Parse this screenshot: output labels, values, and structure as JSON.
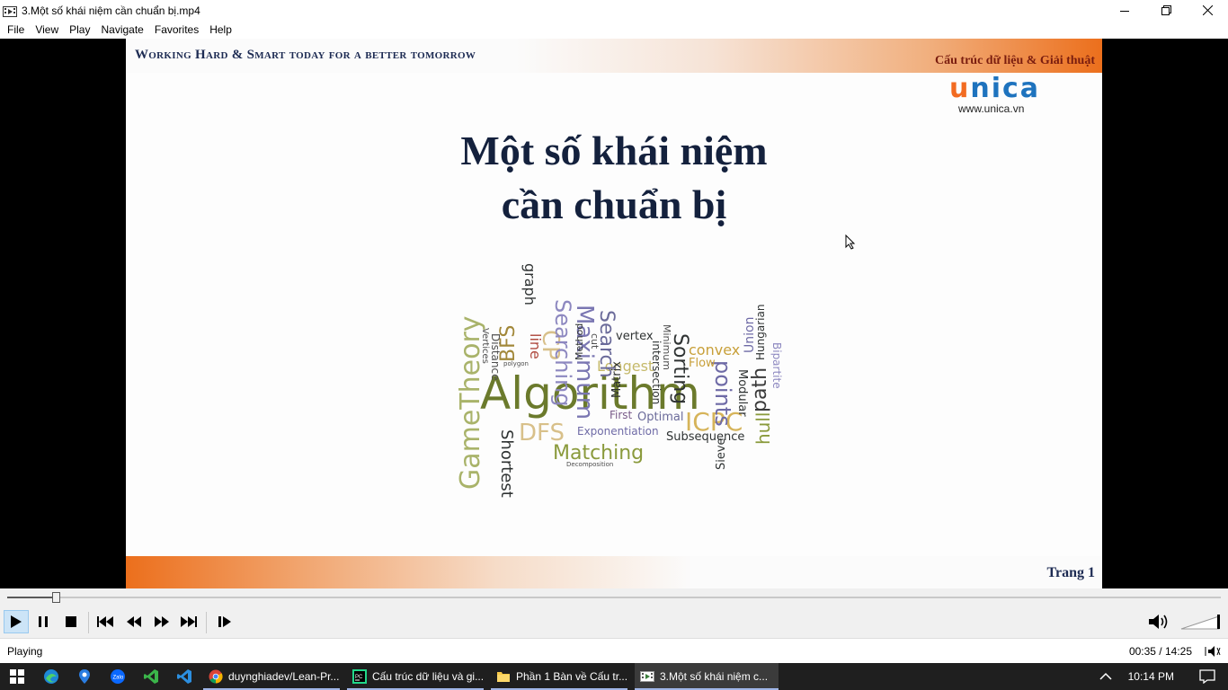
{
  "window": {
    "title": "3.Một số khái niệm cần chuẩn bị.mp4",
    "minimize_icon": "minimize-icon",
    "maximize_icon": "restore-icon",
    "close_icon": "close-icon"
  },
  "menu": [
    "File",
    "View",
    "Play",
    "Navigate",
    "Favorites",
    "Help"
  ],
  "slide": {
    "motto": "Working Hard & Smart today for a better tomorrow",
    "course": "Cấu trúc dữ liệu & Giải thuật",
    "logo_u": "u",
    "logo_rest": "nica",
    "site": "www.unica.vn",
    "heading_line1": "Một số khái niệm",
    "heading_line2": "cần chuẩn bị",
    "page": "Trang 1",
    "wordcloud": {
      "main": "Algorithm",
      "words": [
        "GameTheory",
        "Shortest",
        "DFS",
        "Matching",
        "Exponentiation",
        "Subsequence",
        "ICPC",
        "Optimal",
        "First",
        "Longest",
        "BFS",
        "CP",
        "line",
        "Searching",
        "Maximum",
        "Search",
        "Sorting",
        "points",
        "convex",
        "vertex",
        "Matrix",
        "intersection",
        "Minimum",
        "Method",
        "Hungarian",
        "Union",
        "path",
        "hull",
        "Modular",
        "Sieve",
        "Flow",
        "Bipartite",
        "graph",
        "Distance",
        "Vertices",
        "cut",
        "polygon",
        "Decomposition"
      ]
    }
  },
  "player": {
    "progress_fraction": 0.041,
    "buttons": {
      "play": "play-icon",
      "pause": "pause-icon",
      "stop": "stop-icon",
      "prev": "previous-icon",
      "rewind": "rewind-icon",
      "forward": "fast-forward-icon",
      "next": "next-icon",
      "frame_step": "frame-step-icon"
    },
    "volume_icon": "speaker-icon"
  },
  "status": {
    "text": "Playing",
    "time": "00:35 / 14:25"
  },
  "taskbar": {
    "pinned": [
      "edge-icon",
      "maps-icon",
      "zalo-icon",
      "visual-studio-icon",
      "vscode-icon"
    ],
    "apps": [
      {
        "label": "duynghiadev/Lean-Pr...",
        "icon": "chrome-icon"
      },
      {
        "label": "Cấu trúc dữ liệu và gi...",
        "icon": "pycharm-icon"
      },
      {
        "label": "Phần 1 Bàn về Cấu tr...",
        "icon": "folder-icon"
      },
      {
        "label": "3.Một số khái niệm c...",
        "icon": "mpc-icon"
      }
    ],
    "clock": "10:14 PM"
  }
}
